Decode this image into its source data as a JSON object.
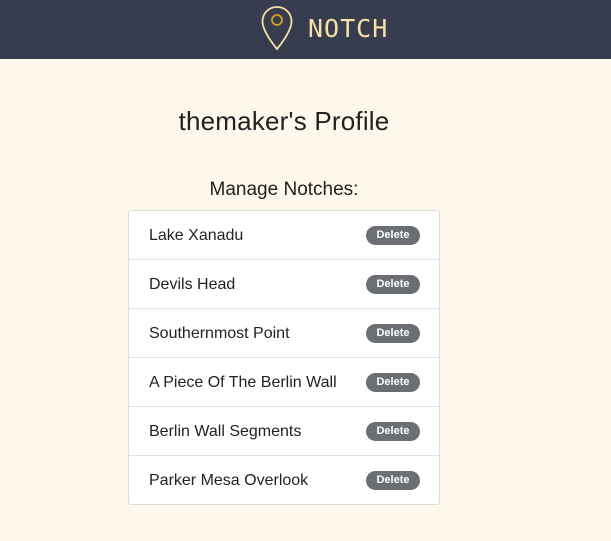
{
  "header": {
    "brand": "NOTCH",
    "icon": "map-pin-icon",
    "brand_color": "#f4e2a6",
    "background": "#373d4f"
  },
  "profile": {
    "title": "themaker's Profile",
    "section_title": "Manage Notches:"
  },
  "notches": [
    {
      "name": "Lake Xanadu",
      "action": "Delete"
    },
    {
      "name": "Devils Head",
      "action": "Delete"
    },
    {
      "name": "Southernmost Point",
      "action": "Delete"
    },
    {
      "name": "A Piece Of The Berlin Wall",
      "action": "Delete"
    },
    {
      "name": "Berlin Wall Segments",
      "action": "Delete"
    },
    {
      "name": "Parker Mesa Overlook",
      "action": "Delete"
    }
  ],
  "colors": {
    "page_background": "#fdf7ec",
    "delete_button": "#6b6f73"
  }
}
